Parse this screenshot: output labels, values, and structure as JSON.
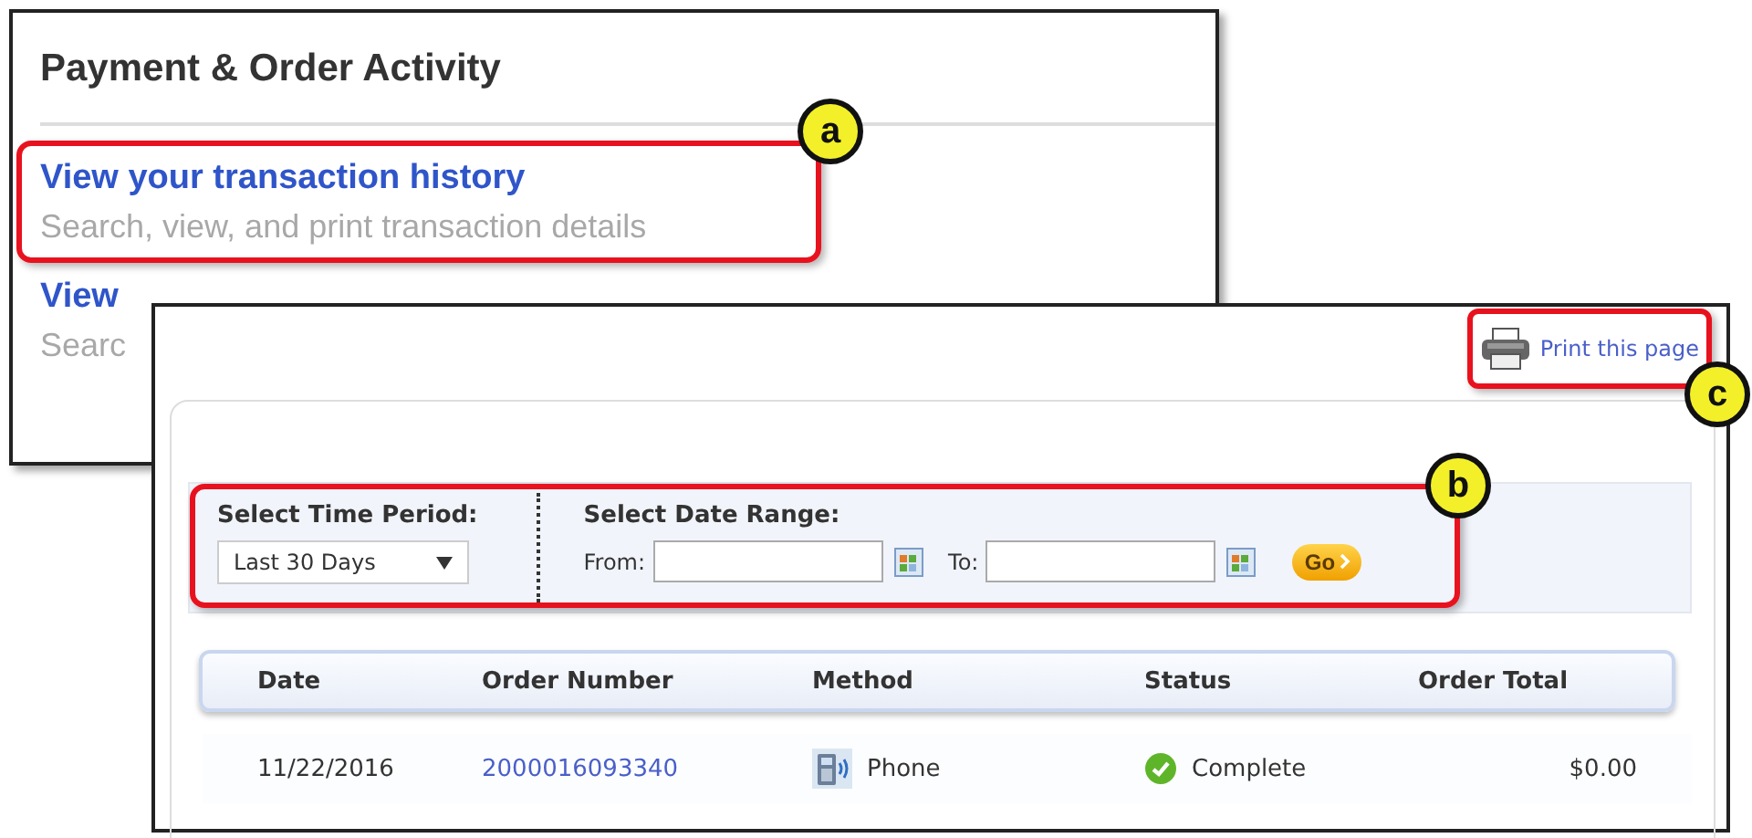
{
  "background_panel": {
    "title": "Payment & Order Activity",
    "links": [
      {
        "label": "View your transaction history",
        "description": "Search, view, and print transaction details"
      },
      {
        "label": "View",
        "description": "Searc"
      }
    ]
  },
  "front_panel": {
    "print_link": "Print this page",
    "filters": {
      "time_period_label": "Select Time Period:",
      "time_period_value": "Last 30 Days",
      "date_range_label": "Select Date Range:",
      "from_label": "From:",
      "to_label": "To:",
      "go_button": "Go"
    },
    "table": {
      "columns": [
        "Date",
        "Order Number",
        "Method",
        "Status",
        "Order Total"
      ],
      "rows": [
        {
          "date": "11/22/2016",
          "order_number": "2000016093340",
          "method": "Phone",
          "status": "Complete",
          "total": "$0.00"
        }
      ]
    }
  },
  "callouts": [
    "a",
    "b",
    "c"
  ]
}
